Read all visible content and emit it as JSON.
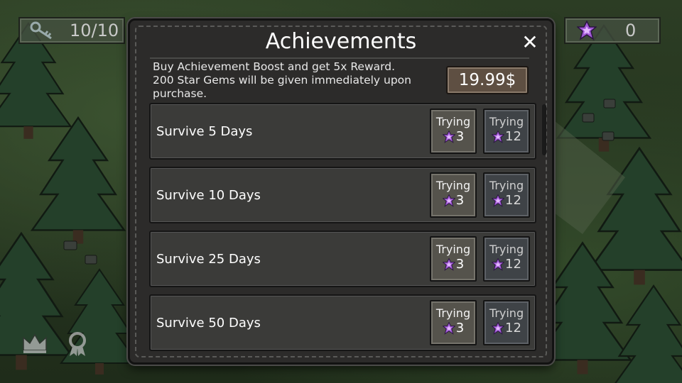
{
  "hud": {
    "keys_value": "10/10",
    "gems_value": "0",
    "keys_icon": "key-icon",
    "gems_icon": "star-gem-icon"
  },
  "panel": {
    "title": "Achievements",
    "close_icon": "close-icon",
    "boost_line1": "Buy Achievement Boost and get 5x Reward.",
    "boost_line2": "200 Star Gems will be given immediately upon purchase.",
    "price": "19.99$"
  },
  "achievements": [
    {
      "label": "Survive 5 Days",
      "normal": {
        "status": "Trying",
        "amount": "3"
      },
      "boost": {
        "status": "Trying",
        "amount": "12"
      }
    },
    {
      "label": "Survive 10 Days",
      "normal": {
        "status": "Trying",
        "amount": "3"
      },
      "boost": {
        "status": "Trying",
        "amount": "12"
      }
    },
    {
      "label": "Survive 25 Days",
      "normal": {
        "status": "Trying",
        "amount": "3"
      },
      "boost": {
        "status": "Trying",
        "amount": "12"
      }
    },
    {
      "label": "Survive 50 Days",
      "normal": {
        "status": "Trying",
        "amount": "3"
      },
      "boost": {
        "status": "Trying",
        "amount": "12"
      }
    }
  ],
  "bottom_icons": [
    "crown-icon",
    "ribbon-badge-icon"
  ],
  "colors": {
    "gem": "#b46be0",
    "price_button": "#5e4f42",
    "panel": "#2c2b2a"
  }
}
